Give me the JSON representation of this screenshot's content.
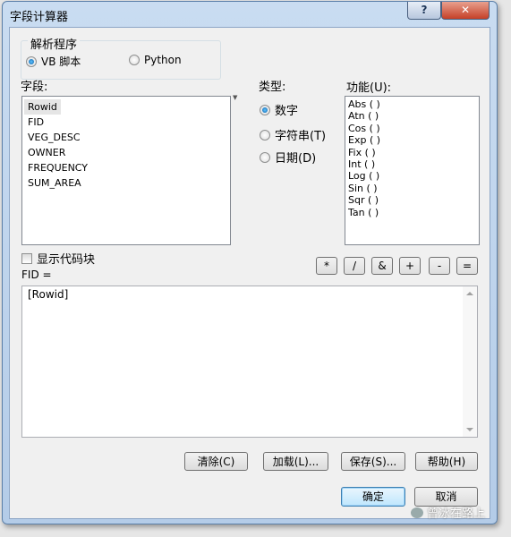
{
  "window": {
    "title": "字段计算器",
    "help_glyph": "?",
    "close_glyph": "✕"
  },
  "parser": {
    "group_label": "解析程序",
    "options": [
      {
        "label": "VB 脚本",
        "selected": true
      },
      {
        "label": "Python",
        "selected": false
      }
    ]
  },
  "fields": {
    "label": "字段:",
    "items": [
      "Rowid",
      "FID",
      "VEG_DESC",
      "OWNER",
      "FREQUENCY",
      "SUM_AREA"
    ],
    "selected_index": 0
  },
  "type": {
    "label": "类型:",
    "options": [
      {
        "label": "数字",
        "selected": true
      },
      {
        "label": "字符串(T)",
        "selected": false
      },
      {
        "label": "日期(D)",
        "selected": false
      }
    ]
  },
  "functions": {
    "label": "功能(U):",
    "items": [
      "Abs ( )",
      "Atn ( )",
      "Cos ( )",
      "Exp ( )",
      "Fix ( )",
      "Int ( )",
      "Log ( )",
      "Sin ( )",
      "Sqr ( )",
      "Tan ( )"
    ]
  },
  "show_code_block": {
    "label": "显示代码块",
    "checked": false
  },
  "operators": [
    "*",
    "/",
    "&",
    "+",
    "-",
    "="
  ],
  "expression": {
    "label": "FID =",
    "value": "[Rowid]"
  },
  "actions": {
    "clear": "清除(C)",
    "load": "加载(L)...",
    "save": "保存(S)...",
    "help": "帮助(H)"
  },
  "dialog": {
    "ok": "确定",
    "cancel": "取消"
  },
  "watermark": "曾冰在路上",
  "colors": {
    "accent": "#3c7fb1",
    "close": "#c54128"
  }
}
